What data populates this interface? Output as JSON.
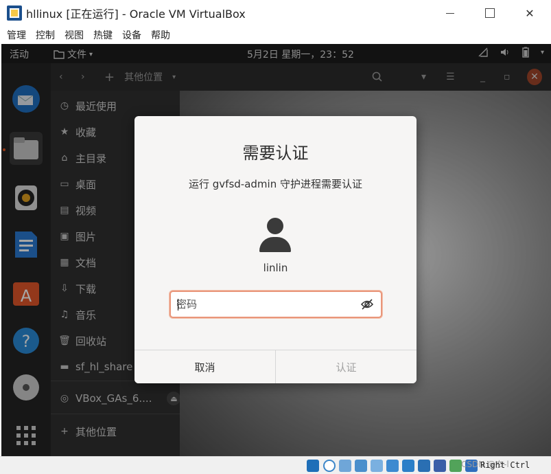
{
  "window": {
    "title": "hllinux [正在运行] - Oracle VM VirtualBox"
  },
  "menubar": {
    "items": [
      "管理",
      "控制",
      "视图",
      "热键",
      "设备",
      "帮助"
    ]
  },
  "guest_topbar": {
    "activities": "活动",
    "app_menu": "文件",
    "clock": "5月2日 星期一，23：52"
  },
  "files": {
    "path_button": "其他位置",
    "sidebar": [
      {
        "label": "最近使用",
        "icon": "clock-icon"
      },
      {
        "label": "收藏",
        "icon": "star-icon"
      },
      {
        "label": "主目录",
        "icon": "home-icon"
      },
      {
        "label": "桌面",
        "icon": "desktop-icon"
      },
      {
        "label": "视频",
        "icon": "video-icon"
      },
      {
        "label": "图片",
        "icon": "image-icon"
      },
      {
        "label": "文档",
        "icon": "document-icon"
      },
      {
        "label": "下载",
        "icon": "download-icon"
      },
      {
        "label": "音乐",
        "icon": "music-icon"
      },
      {
        "label": "回收站",
        "icon": "trash-icon"
      },
      {
        "label": "sf_hl_share",
        "icon": "drive-icon"
      },
      {
        "label": "VBox_GAs_6....",
        "icon": "disc-icon"
      },
      {
        "label": "其他位置",
        "icon": "plus-icon"
      }
    ]
  },
  "auth_dialog": {
    "title": "需要认证",
    "message": "运行 gvfsd-admin 守护进程需要认证",
    "username": "linlin",
    "password_placeholder": "密码",
    "cancel_label": "取消",
    "authenticate_label": "认证"
  },
  "statusbar": {
    "host_key": "Right Ctrl",
    "watermark": "CSDN @冭-l"
  },
  "colors": {
    "accent": "#e95420",
    "focus_border": "#e9967a"
  }
}
